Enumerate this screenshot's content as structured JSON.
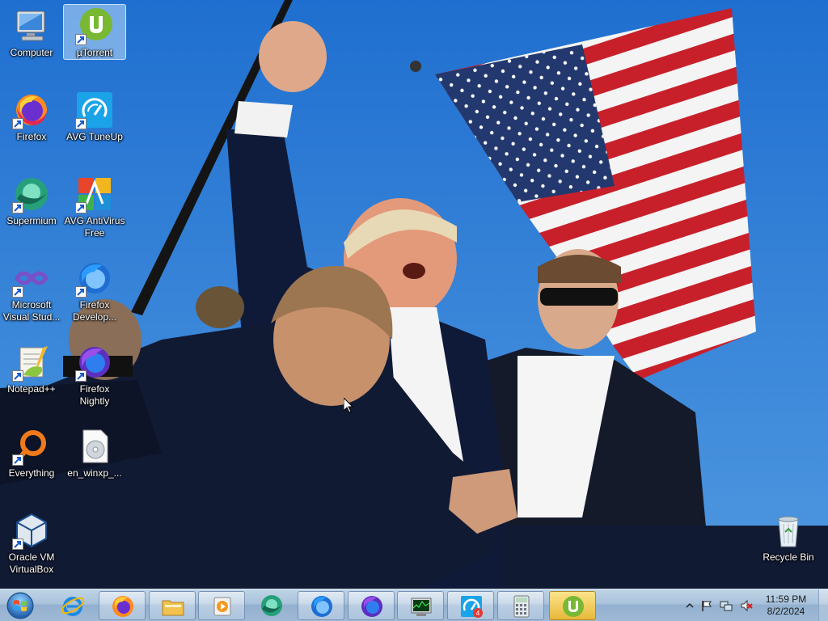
{
  "desktop": {
    "icons": [
      {
        "label": "Computer",
        "icon": "computer-icon",
        "shortcut": false,
        "selected": false
      },
      {
        "label": "µTorrent",
        "icon": "utorrent-icon",
        "shortcut": true,
        "selected": true
      },
      {
        "label": "Firefox",
        "icon": "firefox-icon",
        "shortcut": true,
        "selected": false
      },
      {
        "label": "AVG TuneUp",
        "icon": "avg-tuneup-icon",
        "shortcut": true,
        "selected": false
      },
      {
        "label": "Supermium",
        "icon": "supermium-icon",
        "shortcut": true,
        "selected": false
      },
      {
        "label": "AVG AntiVirus Free",
        "icon": "avg-antivirus-icon",
        "shortcut": true,
        "selected": false
      },
      {
        "label": "Microsoft Visual Stud...",
        "icon": "visual-studio-icon",
        "shortcut": true,
        "selected": false
      },
      {
        "label": "Firefox Develop...",
        "icon": "firefox-developer-icon",
        "shortcut": true,
        "selected": false
      },
      {
        "label": "Notepad++",
        "icon": "notepad-plus-plus-icon",
        "shortcut": true,
        "selected": false
      },
      {
        "label": "Firefox Nightly",
        "icon": "firefox-nightly-icon",
        "shortcut": true,
        "selected": false
      },
      {
        "label": "Everything",
        "icon": "everything-search-icon",
        "shortcut": true,
        "selected": false
      },
      {
        "label": "en_winxp_...",
        "icon": "disc-image-icon",
        "shortcut": false,
        "selected": false
      },
      {
        "label": "Oracle VM VirtualBox",
        "icon": "virtualbox-icon",
        "shortcut": true,
        "selected": false
      },
      {
        "label": "Recycle Bin",
        "icon": "recycle-bin-icon",
        "shortcut": false,
        "selected": false
      }
    ]
  },
  "taskbar": {
    "start": {
      "icon": "windows-start-orb-icon"
    },
    "buttons": [
      {
        "icon": "internet-explorer-icon",
        "state": "pinned"
      },
      {
        "icon": "firefox-icon",
        "state": "open"
      },
      {
        "icon": "file-explorer-icon",
        "state": "open"
      },
      {
        "icon": "media-player-icon",
        "state": "open"
      },
      {
        "icon": "supermium-icon",
        "state": "pinned"
      },
      {
        "icon": "firefox-developer-icon",
        "state": "open"
      },
      {
        "icon": "firefox-nightly-icon",
        "state": "open"
      },
      {
        "icon": "task-manager-icon",
        "state": "open"
      },
      {
        "icon": "avg-tuneup-icon",
        "state": "open",
        "badge": "4"
      },
      {
        "icon": "calculator-icon",
        "state": "open"
      },
      {
        "icon": "utorrent-icon",
        "state": "active"
      }
    ],
    "tray": {
      "icons": [
        "show-hidden-icons-chevron-icon",
        "action-center-flag-icon",
        "network-icon",
        "volume-muted-icon"
      ],
      "time": "11:59 PM",
      "date": "8/2/2024"
    }
  },
  "colors": {
    "sky": "#2f7fd6",
    "taskbar": "#a9c2db",
    "active_button": "#e8b83a",
    "utorrent_green": "#78b833"
  }
}
